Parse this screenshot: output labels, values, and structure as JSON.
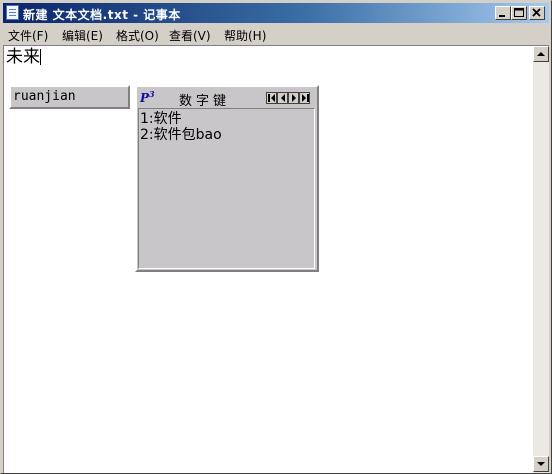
{
  "window": {
    "title": "新建 文本文档.txt - 记事本"
  },
  "menu": [
    {
      "label": "文件(F)"
    },
    {
      "label": "编辑(E)"
    },
    {
      "label": "格式(O)"
    },
    {
      "label": "查看(V)"
    },
    {
      "label": "帮助(H)"
    }
  ],
  "editor": {
    "content": "未来"
  },
  "ime": {
    "composition": "ruanjian",
    "logo": "P",
    "logo_sup": "3",
    "title": "数字键",
    "candidates": [
      {
        "text": "1:软件"
      },
      {
        "text": "2:软件包bao"
      }
    ]
  },
  "colors": {
    "title_active": "#0a246a",
    "face": "#d4d0c8",
    "ime_panel": "#c8c6c8"
  },
  "icons": {
    "app": "notepad-icon",
    "minimize": "minimize-icon",
    "maximize": "maximize-icon",
    "close": "close-icon"
  }
}
